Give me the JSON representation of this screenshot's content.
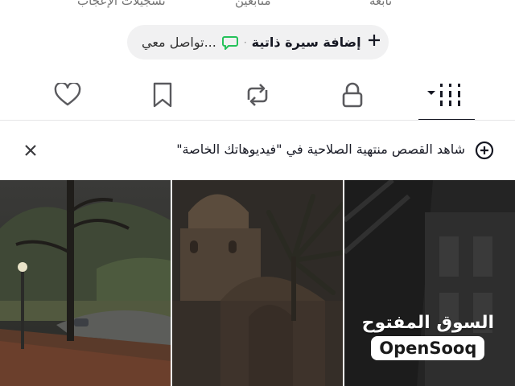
{
  "stats": {
    "likes_label": "تسجيلات الإعجاب",
    "followers_label": "متابعين",
    "following_label": "تابعة"
  },
  "pill": {
    "add_bio_label": "إضافة سيرة ذاتية",
    "separator": "·",
    "contact_placeholder": "تواصل معي..."
  },
  "tabs": [
    {
      "name": "videos-grid",
      "icon": "grid-icon",
      "active": true
    },
    {
      "name": "private",
      "icon": "lock-icon",
      "active": false
    },
    {
      "name": "reposts",
      "icon": "repost-icon",
      "active": false
    },
    {
      "name": "favorites",
      "icon": "bookmark-icon",
      "active": false
    },
    {
      "name": "liked",
      "icon": "heart-icon",
      "active": false
    }
  ],
  "banner": {
    "text": "شاهد القصص منتهية الصلاحية في \"فيديوهاتك الخاصة\"",
    "icon": "story-add-icon",
    "close_icon": "close-icon"
  },
  "watermark": {
    "arabic": "السوق المفتوح",
    "english": "OpenSooq"
  },
  "colors": {
    "accent_green": "#25c25a",
    "text_primary": "#161823",
    "muted": "#757575"
  }
}
